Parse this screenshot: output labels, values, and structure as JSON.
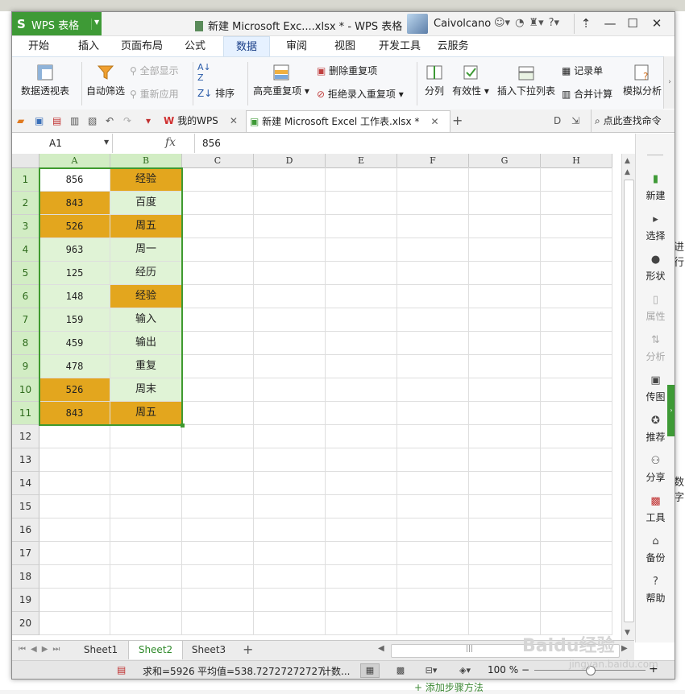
{
  "app": {
    "name": "WPS 表格",
    "logo": "S",
    "window_title": "新建 Microsoft Exc....xlsx * - WPS 表格",
    "user": "Caivolcano",
    "accent": "#3e9a36"
  },
  "ribbon_tabs": [
    "开始",
    "插入",
    "页面布局",
    "公式",
    "数据",
    "审阅",
    "视图",
    "开发工具",
    "云服务"
  ],
  "active_tab": "数据",
  "ribbon": {
    "pivot": "数据透视表",
    "autofilter": "自动筛选",
    "show_all": "全部显示",
    "reapply": "重新应用",
    "sort": "排序",
    "highlight_dup": "高亮重复项",
    "remove_dup": "删除重复项",
    "reject_dup": "拒绝录入重复项",
    "split": "分列",
    "validity": "有效性",
    "insert_dropdown": "插入下拉列表",
    "record_form": "记录单",
    "consolidate": "合并计算",
    "what_if": "模拟分析"
  },
  "doc_tabs": {
    "mywps": "我的WPS",
    "file": "新建 Microsoft Excel 工作表.xlsx *",
    "find_cmd": "点此查找命令"
  },
  "formula_bar": {
    "name_box": "A1",
    "fx": "fx",
    "value": "856"
  },
  "columns": [
    "A",
    "B",
    "C",
    "D",
    "E",
    "F",
    "G",
    "H"
  ],
  "rows": [
    "1",
    "2",
    "3",
    "4",
    "5",
    "6",
    "7",
    "8",
    "9",
    "10",
    "11",
    "12",
    "13",
    "14",
    "15",
    "16",
    "17",
    "18",
    "19",
    "20"
  ],
  "cells": [
    {
      "a": "856",
      "b": "经验",
      "a_hl": false,
      "b_hl": true
    },
    {
      "a": "843",
      "b": "百度",
      "a_hl": true,
      "b_hl": false
    },
    {
      "a": "526",
      "b": "周五",
      "a_hl": true,
      "b_hl": true
    },
    {
      "a": "963",
      "b": "周一",
      "a_hl": false,
      "b_hl": false
    },
    {
      "a": "125",
      "b": "经历",
      "a_hl": false,
      "b_hl": false
    },
    {
      "a": "148",
      "b": "经验",
      "a_hl": false,
      "b_hl": true
    },
    {
      "a": "159",
      "b": "输入",
      "a_hl": false,
      "b_hl": false
    },
    {
      "a": "459",
      "b": "输出",
      "a_hl": false,
      "b_hl": false
    },
    {
      "a": "478",
      "b": "重复",
      "a_hl": false,
      "b_hl": false
    },
    {
      "a": "526",
      "b": "周末",
      "a_hl": true,
      "b_hl": false
    },
    {
      "a": "843",
      "b": "周五",
      "a_hl": true,
      "b_hl": true
    }
  ],
  "colors": {
    "duplicate_highlight": "#e3a61e",
    "selection_fill": "#e0f3d6",
    "selection_border": "#3f9a2f"
  },
  "side_pane": [
    "新建",
    "选择",
    "形状",
    "属性",
    "分析",
    "传图",
    "推荐",
    "分享",
    "工具",
    "备份",
    "帮助"
  ],
  "side_pane_disabled": [
    "属性",
    "分析"
  ],
  "sheets": [
    "Sheet1",
    "Sheet2",
    "Sheet3"
  ],
  "active_sheet": "Sheet2",
  "status": {
    "sum": "求和=5926",
    "avg": "平均值=538.72727272727",
    "count": "计数...",
    "zoom": "100 %"
  },
  "background": {
    "text_right_1": "进行",
    "text_right_2": "数字",
    "add_step": "+ 添加步骤方法"
  },
  "watermark": {
    "brand": "Baidu经验",
    "url": "jingyan.baidu.com"
  }
}
